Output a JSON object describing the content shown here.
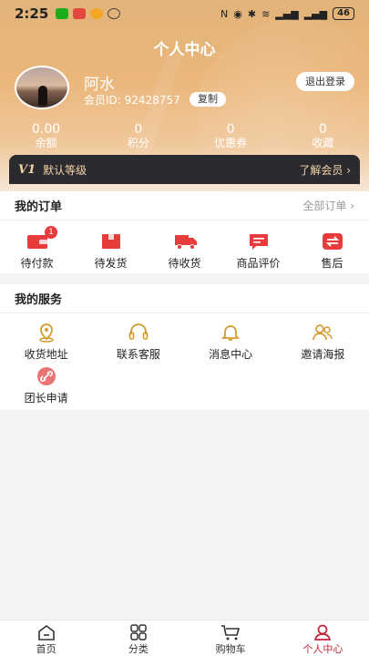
{
  "status_bar": {
    "time": "2:25",
    "battery": "46"
  },
  "header": {
    "title": "个人中心"
  },
  "profile": {
    "nickname": "阿水",
    "member_id": "会员ID: 92428757",
    "copy_label": "复制",
    "logout_label": "退出登录"
  },
  "stats": [
    {
      "value": "0.00",
      "label": "余额"
    },
    {
      "value": "0",
      "label": "积分"
    },
    {
      "value": "0",
      "label": "优惠券"
    },
    {
      "value": "0",
      "label": "收藏"
    }
  ],
  "vip": {
    "badge": "V1",
    "level": "默认等级",
    "more": "了解会员 ›"
  },
  "orders": {
    "title": "我的订单",
    "more": "全部订单 ›",
    "items": [
      {
        "label": "待付款",
        "icon": "wallet-icon",
        "badge": "1"
      },
      {
        "label": "待发货",
        "icon": "box-icon"
      },
      {
        "label": "待收货",
        "icon": "truck-icon"
      },
      {
        "label": "商品评价",
        "icon": "comment-icon"
      },
      {
        "label": "售后",
        "icon": "exchange-icon"
      }
    ]
  },
  "services": {
    "title": "我的服务",
    "items": [
      {
        "label": "收货地址",
        "icon": "location-icon"
      },
      {
        "label": "联系客服",
        "icon": "headset-icon"
      },
      {
        "label": "消息中心",
        "icon": "bell-icon"
      },
      {
        "label": "邀请海报",
        "icon": "invite-icon"
      },
      {
        "label": "团长申请",
        "icon": "link-icon"
      }
    ]
  },
  "tabbar": [
    {
      "label": "首页",
      "icon": "home-icon"
    },
    {
      "label": "分类",
      "icon": "grid-icon"
    },
    {
      "label": "购物车",
      "icon": "cart-icon"
    },
    {
      "label": "个人中心",
      "icon": "user-icon",
      "active": true
    }
  ],
  "colors": {
    "accent": "#c0263a",
    "order_red": "#e83b3b",
    "service_gold": "#d59a2d",
    "hero": "#e8b47a"
  }
}
